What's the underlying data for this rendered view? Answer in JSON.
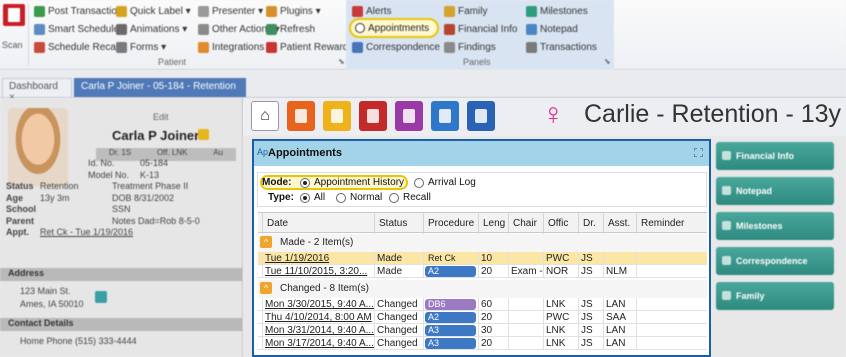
{
  "ribbon": {
    "scan_label": "Scan",
    "patient_group": {
      "label": "Patient",
      "col1": [
        {
          "label": "Post Transaction",
          "icon": "post-transaction-icon",
          "color": "#3a9b4a"
        },
        {
          "label": "Smart Scheduler",
          "icon": "smart-scheduler-icon",
          "color": "#5d8bc3"
        },
        {
          "label": "Schedule Recall",
          "icon": "schedule-recall-icon",
          "color": "#c94a3a"
        }
      ],
      "col2": [
        {
          "label": "Quick Label ▾",
          "icon": "quick-label-icon",
          "color": "#d6a321"
        },
        {
          "label": "Animations ▾",
          "icon": "animations-icon",
          "color": "#6a6a6a"
        },
        {
          "label": "Forms ▾",
          "icon": "forms-icon",
          "color": "#7a7a7a"
        }
      ],
      "col3": [
        {
          "label": "Presenter ▾",
          "icon": "presenter-icon",
          "color": "#9a9a9a"
        },
        {
          "label": "Other Actions ▾",
          "icon": "other-actions-icon",
          "color": "#8a8a8a"
        },
        {
          "label": "Integrations ▾",
          "icon": "integrations-icon",
          "color": "#e08a2b"
        }
      ],
      "col4": [
        {
          "label": "Plugins ▾",
          "icon": "plugins-icon",
          "color": "#d68f2a"
        },
        {
          "label": "Refresh",
          "icon": "refresh-icon",
          "color": "#3f8f5a"
        },
        {
          "label": "Patient Rewards",
          "icon": "patient-rewards-icon",
          "color": "#c63434"
        }
      ]
    },
    "panels_group": {
      "label": "Panels",
      "col1": [
        {
          "label": "Alerts",
          "icon": "alerts-icon",
          "color": "#c93a3a"
        },
        {
          "label": "Appointments",
          "icon": "appointments-icon",
          "color": "#ffffff"
        },
        {
          "label": "Correspondence",
          "icon": "correspondence-icon",
          "color": "#4a74b8"
        }
      ],
      "col2": [
        {
          "label": "Family",
          "icon": "family-icon",
          "color": "#d3a32c"
        },
        {
          "label": "Financial Info",
          "icon": "financial-info-icon",
          "color": "#b5452d"
        },
        {
          "label": "Findings",
          "icon": "findings-icon",
          "color": "#8a8a8a"
        }
      ],
      "col3": [
        {
          "label": "Milestones",
          "icon": "milestones-icon",
          "color": "#2e9c7e"
        },
        {
          "label": "Notepad",
          "icon": "notepad-icon",
          "color": "#4a86c4"
        },
        {
          "label": "Transactions",
          "icon": "transactions-icon",
          "color": "#7a7a7a"
        }
      ]
    },
    "launcher_glyph": "⬊"
  },
  "tabs": [
    {
      "label": "Dashboard ×"
    },
    {
      "label": "Carla P Joiner - 05-184 - Retention"
    }
  ],
  "patient_panel": {
    "edit": "Edit",
    "name": "Carla P Joiner",
    "flags": [
      "Dr. 1S",
      "Off. LNK",
      "Au"
    ],
    "rows": [
      {
        "label": "",
        "value": "Id. No.",
        "value2": "05-184"
      },
      {
        "label": "",
        "value": "Model No.",
        "value2": "K-13"
      },
      {
        "label": "Status",
        "value": "Retention",
        "value2": "Treatment  Phase II"
      },
      {
        "label": "Age",
        "value": "13y 3m",
        "value2": "DOB  8/31/2002"
      },
      {
        "label": "School",
        "value": "",
        "value2": "SSN"
      },
      {
        "label": "Parent",
        "value": "",
        "value2": "Notes  Dad=Rob  8-5-0"
      },
      {
        "label": "Appt.",
        "value": "Ret Ck - Tue 1/19/2016",
        "value2": ""
      }
    ],
    "address_header": "Address",
    "address_lines": [
      "123 Main St.",
      "Ames, IA 50010"
    ],
    "contact_header": "Contact Details",
    "contact_row": "Home Phone  (515) 333-4444"
  },
  "header": {
    "title": "Carlie - Retention - 13y",
    "home_glyph": "⌂",
    "female_glyph": "♀",
    "category_icons": [
      {
        "name": "orange-chart-icon",
        "color": "#e8641e"
      },
      {
        "name": "yellow-doc-icon",
        "color": "#f0b21a"
      },
      {
        "name": "red-gift-icon",
        "color": "#c52a2a"
      },
      {
        "name": "purple-umbrella-icon",
        "color": "#9a3aa6"
      },
      {
        "name": "blue-link-icon",
        "color": "#2f78c9"
      },
      {
        "name": "blue-camera-icon",
        "color": "#2a63b5"
      }
    ]
  },
  "side_buttons": [
    "Financial Info",
    "Notepad",
    "Milestones",
    "Correspondence",
    "Family"
  ],
  "dialog": {
    "title": "Appointments",
    "title_icon": "Ap",
    "mode_label": "Mode:",
    "mode_options": [
      "Appointment History",
      "Arrival Log"
    ],
    "mode_selected": "Appointment History",
    "type_label": "Type:",
    "type_options": [
      "All",
      "Normal",
      "Recall"
    ],
    "type_selected": "All",
    "columns": [
      "Date",
      "Status",
      "Procedure",
      "Leng",
      "Chair",
      "Offic",
      "Dr.",
      "Asst.",
      "Reminder"
    ],
    "groups": [
      {
        "label": "Made - 2 Item(s)",
        "toggle": "^",
        "rows": [
          {
            "date": "Tue 1/19/2016",
            "status": "Made",
            "procedure": "Ret Ck",
            "proc_color": "#fbe6a6",
            "length": "10",
            "chair": "",
            "office": "PWC",
            "dr": "JS",
            "asst": "",
            "reminder": "",
            "selected": true
          },
          {
            "date": "Tue 11/10/2015, 3:20...",
            "status": "Made",
            "procedure": "A2",
            "proc_color": "#3d78c4",
            "length": "20",
            "chair": "Exam -",
            "office": "NOR",
            "dr": "JS",
            "asst": "NLM",
            "reminder": "",
            "selected": false
          }
        ]
      },
      {
        "label": "Changed - 8 Item(s)",
        "toggle": "^",
        "rows": [
          {
            "date": "Mon 3/30/2015, 9:40 A...",
            "status": "Changed",
            "procedure": "DB6",
            "proc_color": "#9a7ac1",
            "length": "60",
            "chair": "",
            "office": "LNK",
            "dr": "JS",
            "asst": "LAN",
            "reminder": "",
            "selected": false
          },
          {
            "date": "Thu 4/10/2014, 8:00 AM",
            "status": "Changed",
            "procedure": "A2",
            "proc_color": "#3d78c4",
            "length": "20",
            "chair": "",
            "office": "PWC",
            "dr": "JS",
            "asst": "SAA",
            "reminder": "",
            "selected": false
          },
          {
            "date": "Mon 3/31/2014, 9:40 A...",
            "status": "Changed",
            "procedure": "A3",
            "proc_color": "#3d78c4",
            "length": "30",
            "chair": "",
            "office": "LNK",
            "dr": "JS",
            "asst": "LAN",
            "reminder": "",
            "selected": false
          },
          {
            "date": "Mon 3/17/2014, 9:40 A...",
            "status": "Changed",
            "procedure": "A3",
            "proc_color": "#3d78c4",
            "length": "20",
            "chair": "",
            "office": "LNK",
            "dr": "JS",
            "asst": "LAN",
            "reminder": "",
            "selected": false
          }
        ]
      }
    ]
  },
  "colors": {
    "highlight": "#e8c50a",
    "dialog_border": "#1a5fa7",
    "dialog_title_bg": "#a3d3e8",
    "side_button": "#2d8a7f",
    "female_pink": "#e0288f"
  }
}
